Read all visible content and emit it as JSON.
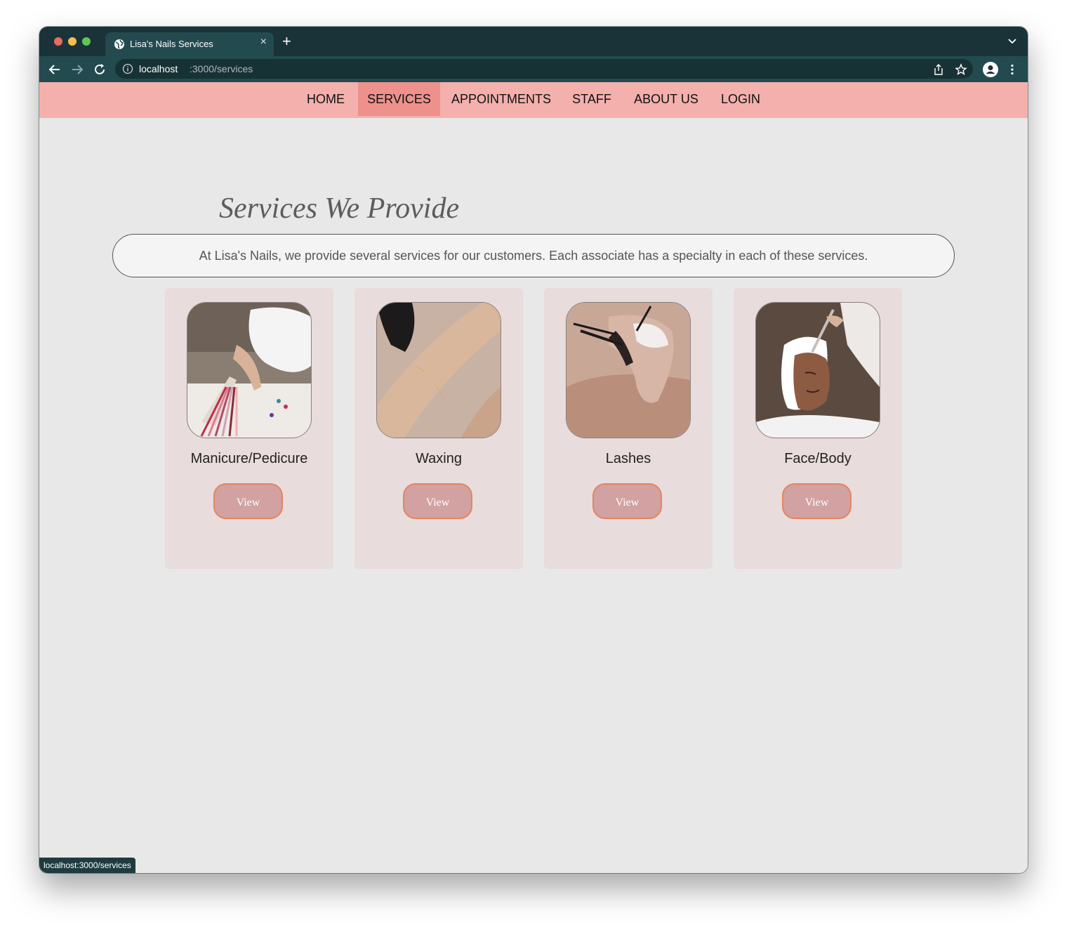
{
  "browser": {
    "tab_title": "Lisa's Nails Services",
    "url_host": "localhost",
    "url_path": ":3000/services",
    "status_url": "localhost:3000/services"
  },
  "nav": {
    "items": [
      {
        "label": "HOME",
        "active": false
      },
      {
        "label": "SERVICES",
        "active": true
      },
      {
        "label": "APPOINTMENTS",
        "active": false
      },
      {
        "label": "STAFF",
        "active": false
      },
      {
        "label": "ABOUT US",
        "active": false
      },
      {
        "label": "LOGIN",
        "active": false
      }
    ]
  },
  "page": {
    "title": "Services We Provide",
    "intro": "At Lisa's Nails, we provide several services for our customers. Each associate has a specialty in each of these services."
  },
  "services": [
    {
      "name": "Manicure/Pedicure",
      "button": "View",
      "image": "nail-polish-swatches-photo"
    },
    {
      "name": "Waxing",
      "button": "View",
      "image": "leg-waxing-photo"
    },
    {
      "name": "Lashes",
      "button": "View",
      "image": "eyelash-extension-photo"
    },
    {
      "name": "Face/Body",
      "button": "View",
      "image": "facial-mask-photo"
    }
  ],
  "colors": {
    "chrome_dark": "#1a3338",
    "chrome_toolbar": "#234a4f",
    "nav_bg": "#f3b0ad",
    "nav_active": "#ee918c",
    "card_bg": "#e8dcdc",
    "button_bg": "#d2a1a1",
    "button_border": "#e38560"
  }
}
